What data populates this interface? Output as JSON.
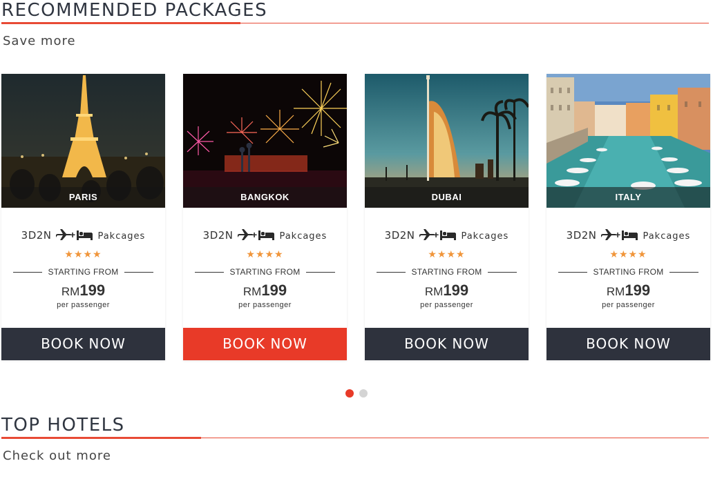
{
  "recommended": {
    "title": "RECOMMENDED PACKAGES",
    "subtitle": "Save more"
  },
  "packages": [
    {
      "city": "PARIS",
      "duration": "3D2N",
      "label": "Pakcages",
      "stars": "★★★★",
      "starting": "STARTING FROM",
      "currency": "RM",
      "price": "199",
      "per": "per passenger",
      "button": "BOOK NOW"
    },
    {
      "city": "BANGKOK",
      "duration": "3D2N",
      "label": "Pakcages",
      "stars": "★★★★",
      "starting": "STARTING FROM",
      "currency": "RM",
      "price": "199",
      "per": "per passenger",
      "button": "BOOK NOW"
    },
    {
      "city": "DUBAI",
      "duration": "3D2N",
      "label": "Pakcages",
      "stars": "★★★★",
      "starting": "STARTING FROM",
      "currency": "RM",
      "price": "199",
      "per": "per passenger",
      "button": "BOOK NOW"
    },
    {
      "city": "ITALY",
      "duration": "3D2N",
      "label": "Pakcages",
      "stars": "★★★★",
      "starting": "STARTING FROM",
      "currency": "RM",
      "price": "199",
      "per": "per passenger",
      "button": "BOOK NOW"
    }
  ],
  "carousel": {
    "pages": 2,
    "active_page": 1
  },
  "top_hotels": {
    "title": "TOP HOTELS",
    "subtitle": "Check out more"
  },
  "colors": {
    "accent": "#e83a28",
    "button_dark": "#2e323d",
    "star": "#f0953a"
  }
}
